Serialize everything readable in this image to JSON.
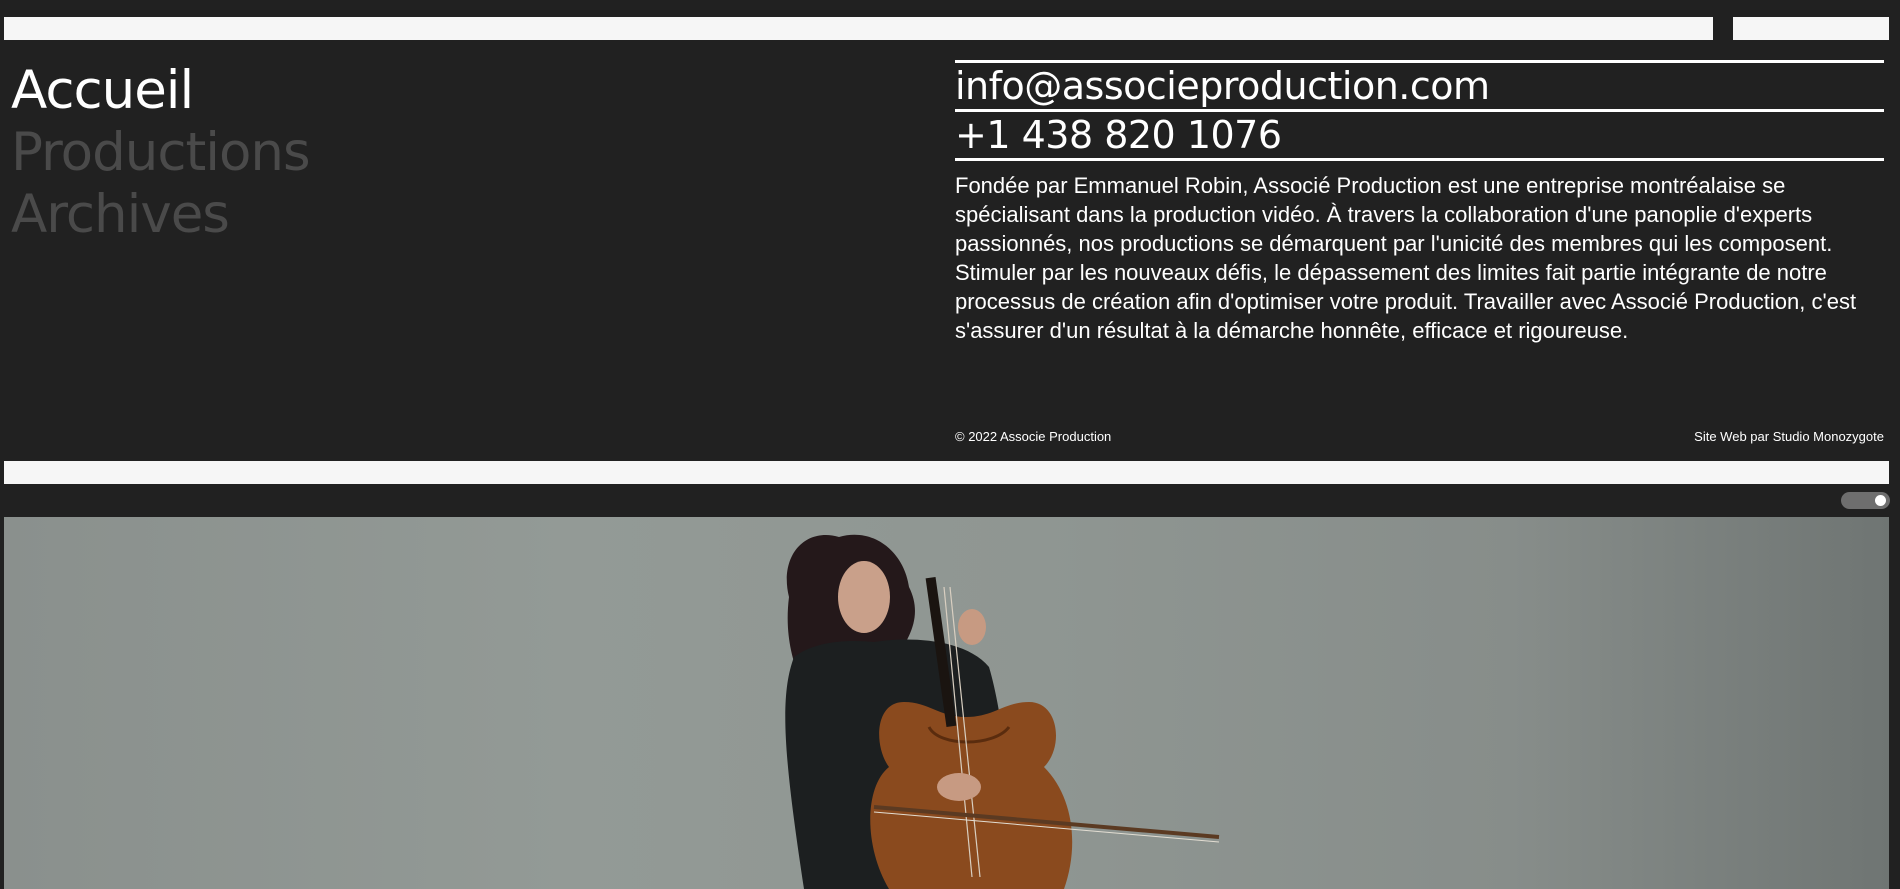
{
  "nav": {
    "items": [
      {
        "label": "Accueil",
        "active": true
      },
      {
        "label": "Productions",
        "active": false
      },
      {
        "label": "Archives",
        "active": false
      }
    ]
  },
  "contact": {
    "email": "info@associeproduction.com",
    "phone": "+1 438 820 1076"
  },
  "about": {
    "description": "Fondée par Emmanuel Robin, Associé Production est une entreprise montréalaise se spécialisant dans la production vidéo. À travers la collaboration d'une panoplie d'experts passionnés, nos productions se démarquent par l'unicité des membres qui les composent. Stimuler par les nouveaux défis, le dépassement des limites fait partie intégrante de notre processus de création afin d'optimiser votre produit. Travailler avec Associé Production, c'est s'assurer d'un résultat à la démarche honnête, efficace et rigoureuse."
  },
  "footer": {
    "copyright": "© 2022 Associe Production",
    "credit": "Site Web par Studio Monozygote"
  },
  "hero": {
    "toggle_state": "on",
    "image_subject": "cellist-performer"
  },
  "colors": {
    "background": "#212121",
    "text": "#ffffff",
    "inactive_nav": "#4a4a4a",
    "bar": "#f6f6f6"
  }
}
